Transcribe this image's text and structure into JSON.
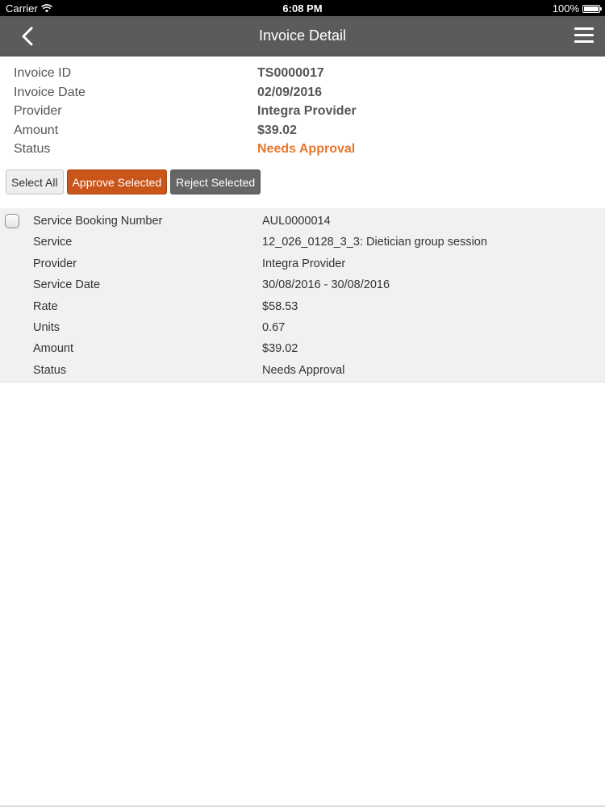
{
  "status_bar": {
    "carrier": "Carrier",
    "time": "6:08 PM",
    "battery": "100%",
    "battery_level": 1.0
  },
  "nav": {
    "title": "Invoice Detail",
    "back_icon": "chevron-left-icon",
    "menu_icon": "hamburger-menu-icon"
  },
  "invoice": [
    {
      "label": "Invoice ID",
      "value": "TS0000017",
      "color": "#555555"
    },
    {
      "label": "Invoice Date",
      "value": "02/09/2016",
      "color": "#555555"
    },
    {
      "label": "Provider",
      "value": "Integra Provider",
      "color": "#555555"
    },
    {
      "label": "Amount",
      "value": "$39.02",
      "color": "#555555"
    },
    {
      "label": "Status",
      "value": "Needs Approval",
      "color": "#e8762c"
    }
  ],
  "actions": {
    "select_all": "Select All",
    "approve_selected": "Approve Selected",
    "reject_selected": "Reject Selected"
  },
  "booking": {
    "checked": false,
    "rows": [
      {
        "label": "Service Booking Number",
        "value": "AUL0000014"
      },
      {
        "label": "Service",
        "value": "12_026_0128_3_3: Dietician group session"
      },
      {
        "label": "Provider",
        "value": "Integra Provider"
      },
      {
        "label": "Service Date",
        "value": "30/08/2016 - 30/08/2016"
      },
      {
        "label": "Rate",
        "value": "$58.53"
      },
      {
        "label": "Units",
        "value": "0.67"
      },
      {
        "label": "Amount",
        "value": "$39.02"
      },
      {
        "label": "Status",
        "value": "Needs Approval"
      }
    ]
  },
  "colors": {
    "nav_bg": "#5b5b5b",
    "approve": "#c9551a",
    "reject": "#666666",
    "status_orange": "#e8762c"
  }
}
